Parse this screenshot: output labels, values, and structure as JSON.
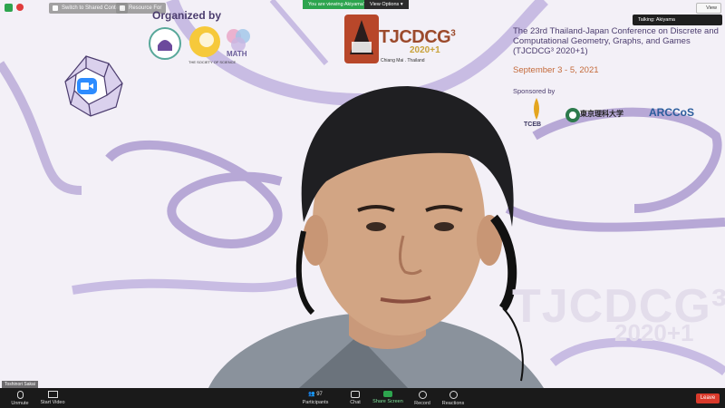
{
  "topbar": {
    "switch_label": "Switch to Shared Content",
    "resource_label": "Resource For",
    "viewing_label": "You are viewing Akiyama's screen",
    "view_options_label": "View Options",
    "view_button_label": "View",
    "talking_label": "Talking: Akiyama"
  },
  "slide": {
    "organized_by": "Organized by",
    "logo_caption_1": "THE SOCIETY OF SCIENCE",
    "math_label": "MATH",
    "tjcdcg_name": "TJCDCG",
    "tjcdcg_sup": "3",
    "tjcdcg_year": "2020+1",
    "tjcdcg_city": "Chiang Mai . Thailand",
    "conference_title": "The 23rd Thailand-Japan Conference on Discrete and Computational Geometry, Graphs, and Games (TJCDCG³ 2020+1)",
    "dates": "September 3 - 5, 2021",
    "sponsored_by": "Sponsored by",
    "sponsor_tceb": "TCEB",
    "sponsor_tokyo": "東京理科大学",
    "sponsor_arccos": "ARCCoS",
    "watermark_name": "TJCDCG³",
    "watermark_year": "2020+1"
  },
  "video": {
    "participant_name": "Toshinori Sakai"
  },
  "toolbar": {
    "unmute": "Unmute",
    "start_video": "Start Video",
    "participants": "Participants",
    "participants_count": "97",
    "chat": "Chat",
    "share_screen": "Share Screen",
    "record": "Record",
    "reactions": "Reactions",
    "leave": "Leave"
  },
  "colors": {
    "accent_green": "#2da44e",
    "leave_red": "#d93a2b",
    "slide_purple": "#4b3c6e",
    "swirl_purple": "#b7a8d6"
  }
}
